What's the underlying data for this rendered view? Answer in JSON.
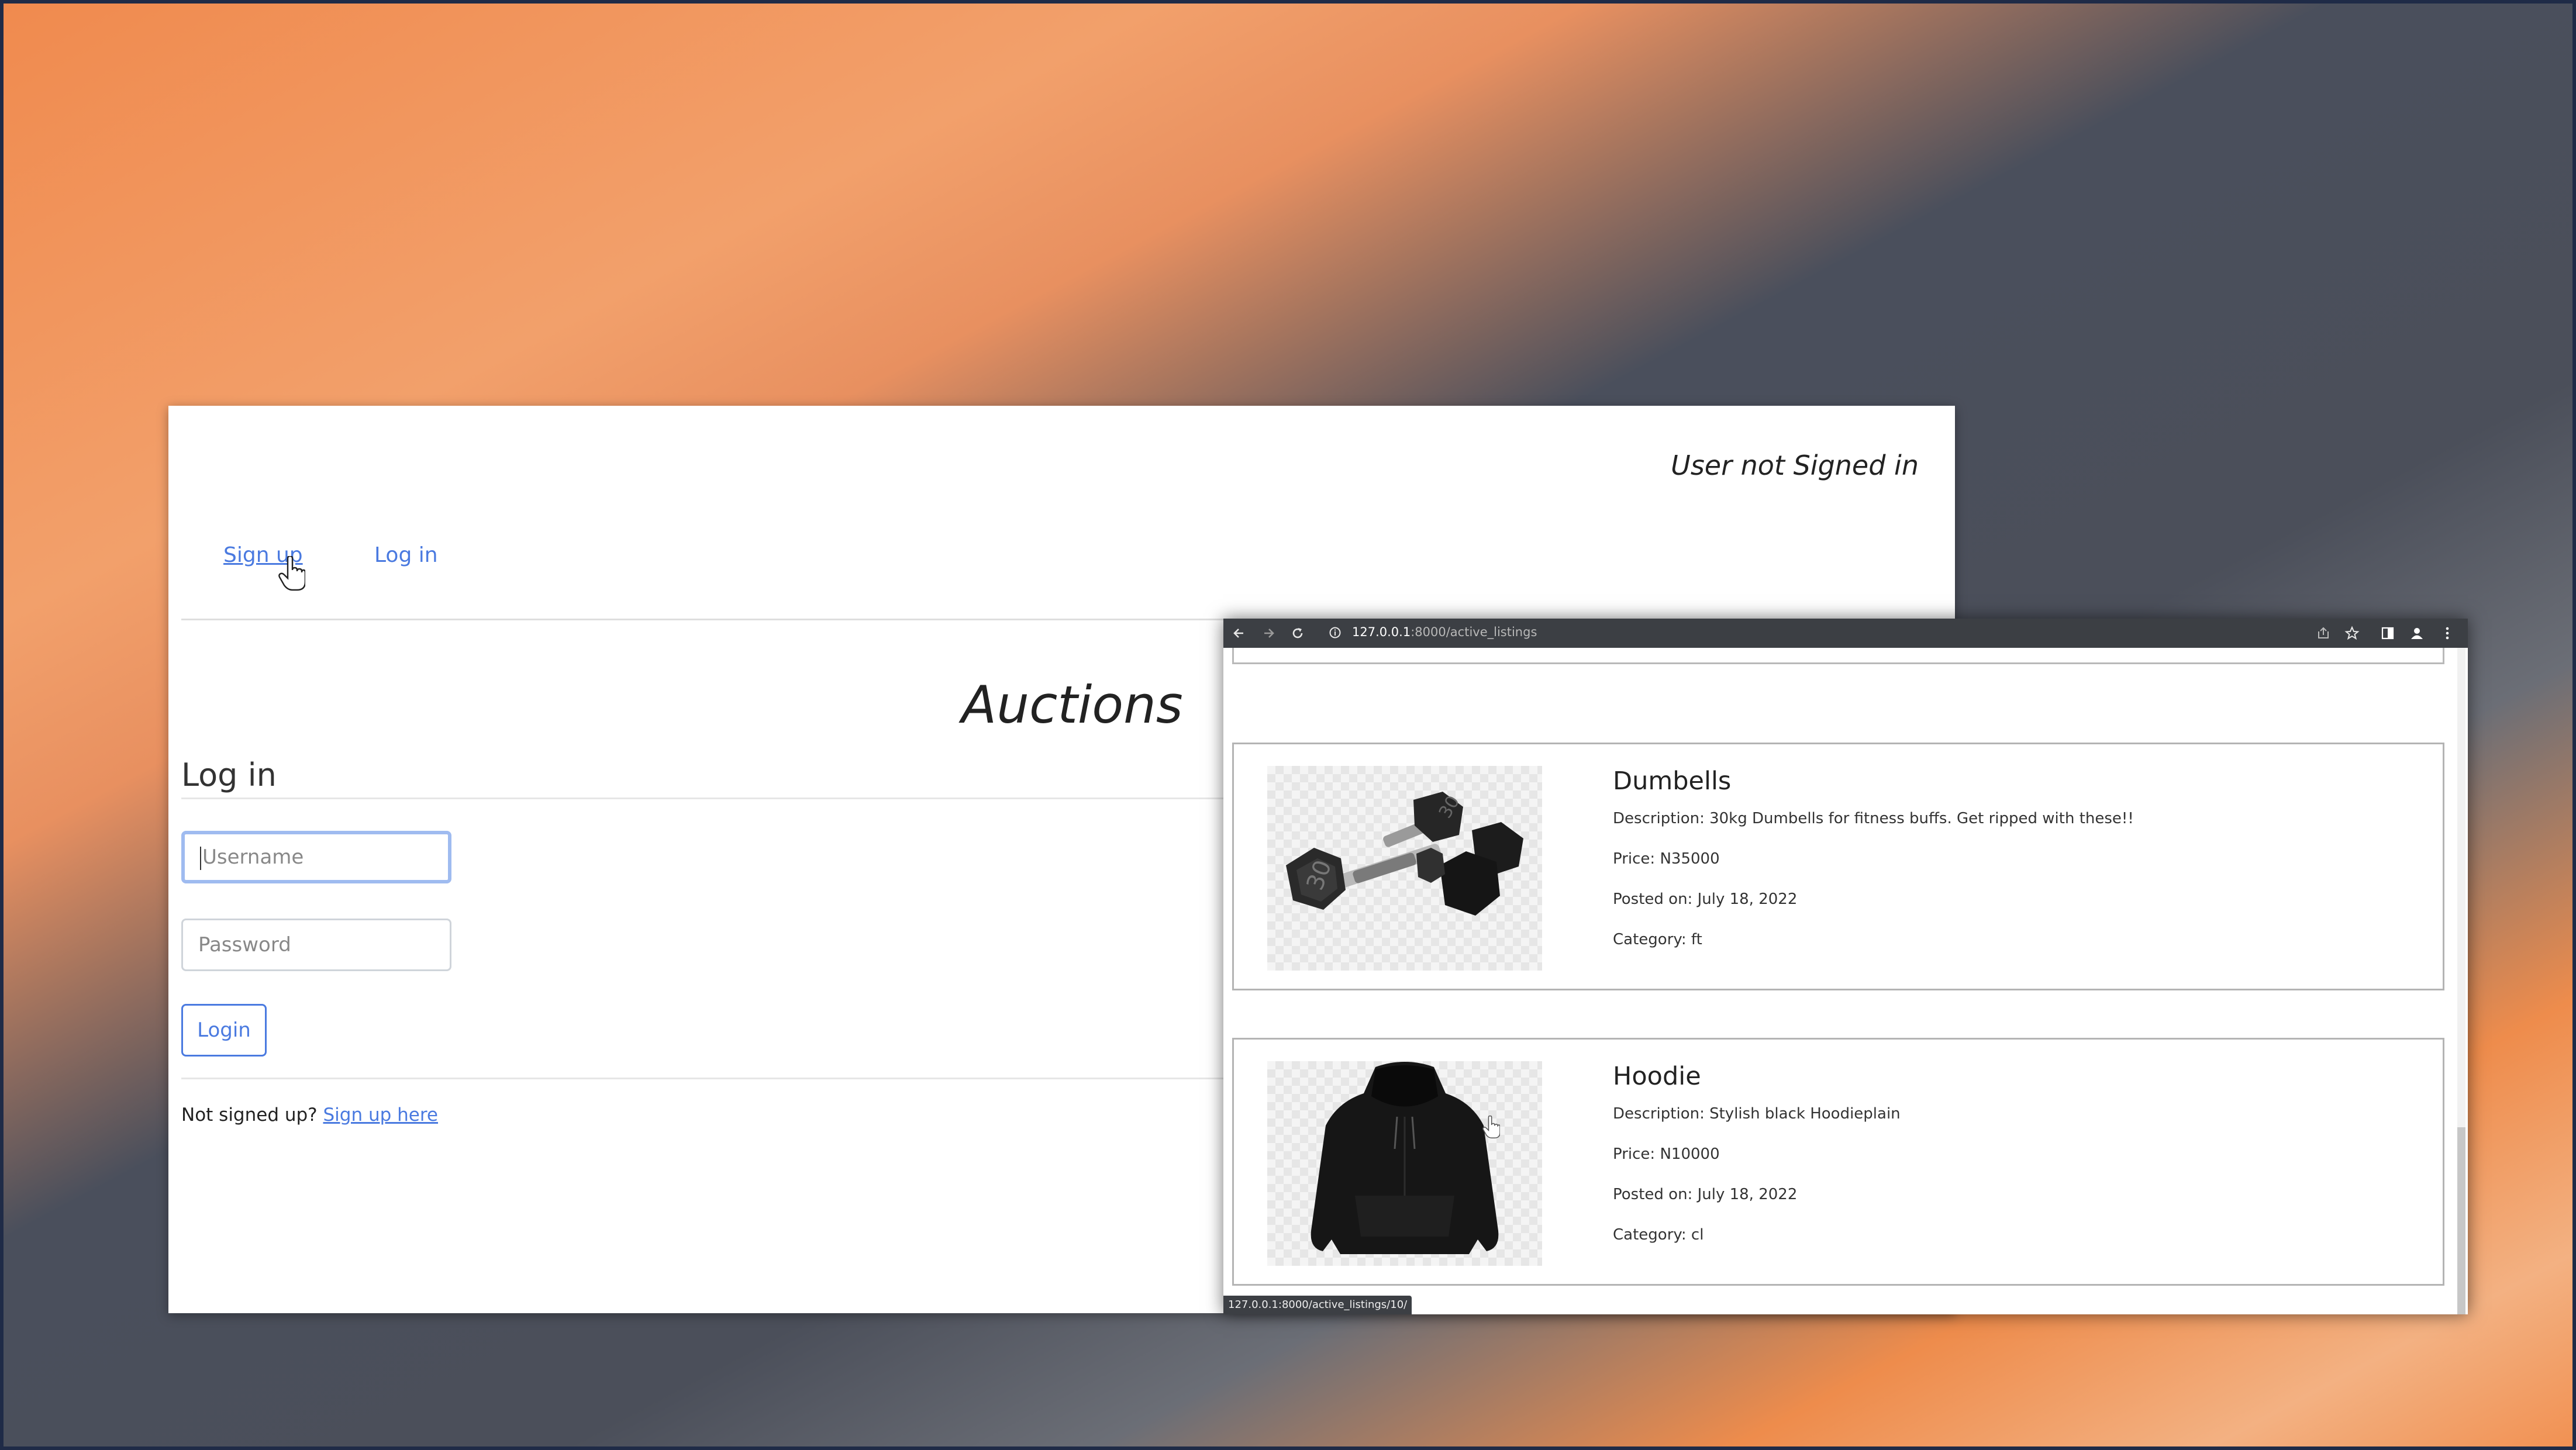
{
  "auctions_page": {
    "user_status": "User not Signed in",
    "nav": {
      "signup": "Sign up",
      "login": "Log in"
    },
    "site_title": "Auctions",
    "login_heading": "Log in",
    "username_placeholder": "Username",
    "password_placeholder": "Password",
    "login_button": "Login",
    "not_signed_text": "Not signed up?",
    "signup_here_link": "Sign up here"
  },
  "browser": {
    "url_host": "127.0.0.1",
    "url_path": ":8000/active_listings",
    "status_url": "127.0.0.1:8000/active_listings/10/",
    "toolbar_icons": [
      "back-arrow-icon",
      "forward-arrow-icon",
      "reload-icon",
      "info-icon",
      "share-icon",
      "star-icon",
      "side-panel-icon",
      "profile-icon",
      "kebab-menu-icon"
    ]
  },
  "listings": [
    {
      "title": "Dumbells",
      "description": "Description: 30kg Dumbells for fitness buffs. Get ripped with these!!",
      "price": "Price: N35000",
      "posted": "Posted on: July 18, 2022",
      "category": "Category: ft",
      "image_icon": "dumbbell-image",
      "plate_labels": [
        "30",
        "30"
      ]
    },
    {
      "title": "Hoodie",
      "description": "Description: Stylish black Hoodieplain",
      "price": "Price: N10000",
      "posted": "Posted on: July 18, 2022",
      "category": "Category: cl",
      "image_icon": "hoodie-image"
    }
  ],
  "colors": {
    "link": "#4a7ae0",
    "toolbar": "#3c3f44",
    "focus_ring": "#9fbbf0"
  }
}
